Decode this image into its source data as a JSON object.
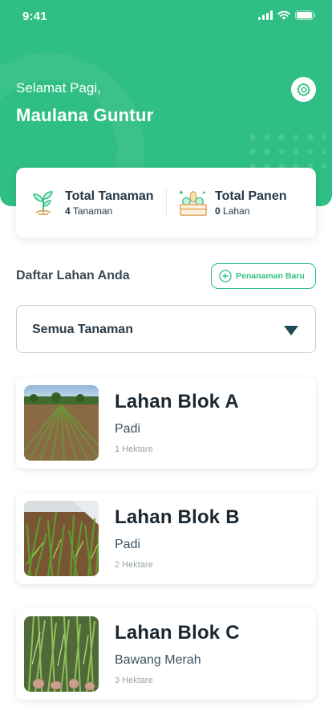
{
  "status_bar": {
    "time": "9:41"
  },
  "header": {
    "greeting": "Selamat Pagi,",
    "user_name": "Maulana Guntur"
  },
  "summary": {
    "plants": {
      "title": "Total Tanaman",
      "count": "4",
      "unit": "Tanaman"
    },
    "harvest": {
      "title": "Total Panen",
      "count": "0",
      "unit": "Lahan"
    }
  },
  "section": {
    "title": "Daftar Lahan Anda",
    "new_button_label": "Penanaman Baru"
  },
  "filter": {
    "selected": "Semua Tanaman"
  },
  "lands": [
    {
      "name": "Lahan Blok A",
      "crop": "Padi",
      "size": "1 Hektare"
    },
    {
      "name": "Lahan Blok B",
      "crop": "Padi",
      "size": "2 Hektare"
    },
    {
      "name": "Lahan Blok C",
      "crop": "Bawang Merah",
      "size": "3 Hektare"
    }
  ],
  "colors": {
    "brand_green": "#2fbf84",
    "dark_teal": "#1e4a56",
    "text_dark": "#1a2630"
  },
  "icons": {
    "settings": "settings-gear-icon",
    "plants": "sprout-icon",
    "harvest": "harvest-box-icon",
    "new": "plus-circle-icon",
    "dropdown": "caret-down-icon"
  }
}
